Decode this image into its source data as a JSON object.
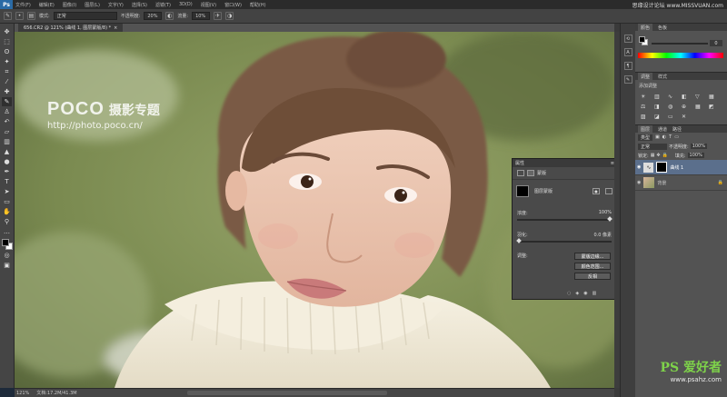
{
  "app": {
    "logo": "Ps"
  },
  "menu": [
    "文件(F)",
    "编辑(E)",
    "图像(I)",
    "图层(L)",
    "文字(Y)",
    "选择(S)",
    "滤镜(T)",
    "3D(D)",
    "视图(V)",
    "窗口(W)",
    "帮助(H)"
  ],
  "watermark_top": "思缘设计论坛 www.MISSVUAN.com",
  "options": {
    "mode_label": "模式:",
    "mode_value": "正常",
    "opacity_label": "不透明度:",
    "opacity_value": "20%",
    "flow_label": "流量:",
    "flow_value": "10%"
  },
  "document_tab": {
    "title": "656.CR2 @ 121% (曲线 1, 图层蒙版/8) *",
    "close": "×"
  },
  "canvas_watermark": {
    "brand": "POCO",
    "subtitle": "摄影专题",
    "url": "http://photo.poco.cn/"
  },
  "status": {
    "zoom": "121%",
    "doc": "文档:17.2M/41.3M"
  },
  "color_panel": {
    "tabs": [
      "颜色",
      "色板"
    ],
    "value": "0"
  },
  "adjust_panel": {
    "tabs": [
      "调整",
      "样式"
    ],
    "title": "添加调整"
  },
  "layers_panel": {
    "tabs": [
      "图层",
      "通道",
      "路径"
    ],
    "kind": "类型",
    "blend": "正常",
    "opacity_label": "不透明度:",
    "opacity_value": "100%",
    "lock_label": "锁定:",
    "fill_label": "填充:",
    "fill_value": "100%",
    "layers": [
      {
        "name": "曲线 1",
        "selected": true
      },
      {
        "name": "背景",
        "selected": false
      }
    ]
  },
  "properties": {
    "title": "属性",
    "kind": "蒙版",
    "mask_label": "图层蒙版",
    "density_label": "浓度:",
    "density_value": "100%",
    "feather_label": "羽化:",
    "feather_value": "0.0 像素",
    "refine_label": "调整:",
    "buttons": [
      "蒙版边缘...",
      "颜色范围...",
      "反相"
    ]
  },
  "watermark_bottom": {
    "brand": "PS 爱好者",
    "url": "www.psahz.com"
  },
  "colors": {
    "accent": "#2a6aa5",
    "panel": "#535353",
    "dark": "#2b2b2b"
  }
}
